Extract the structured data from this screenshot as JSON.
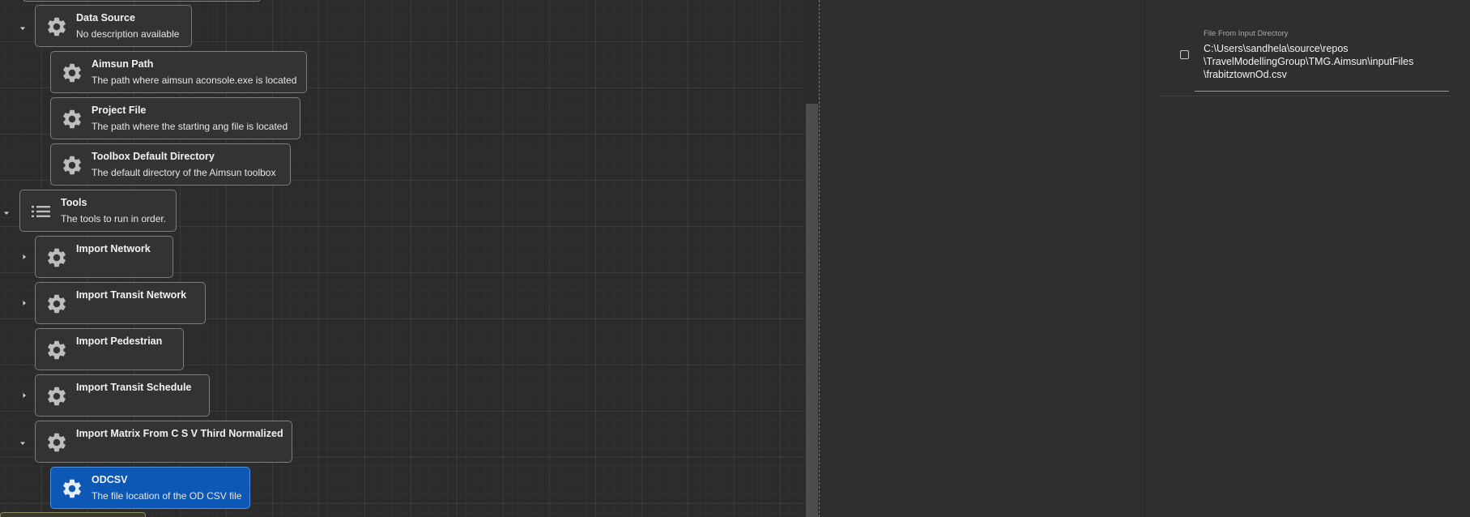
{
  "tree": {
    "nodes": [
      {
        "id": "data-source",
        "title": "Data Source",
        "description": "No description available",
        "icon": "gear-icon",
        "expanded": true
      },
      {
        "id": "aimsun-path",
        "title": "Aimsun Path",
        "description": "The path where aimsun aconsole.exe is located",
        "icon": "gear-icon"
      },
      {
        "id": "project-file",
        "title": "Project File",
        "description": "The path where the starting ang file is located",
        "icon": "gear-icon"
      },
      {
        "id": "toolbox-default-directory",
        "title": "Toolbox Default Directory",
        "description": "The default directory of the Aimsun toolbox",
        "icon": "gear-icon"
      },
      {
        "id": "tools",
        "title": "Tools",
        "description": "The tools to run in order.",
        "icon": "list-icon",
        "expanded": true
      },
      {
        "id": "import-network",
        "title": "Import Network",
        "description": "",
        "icon": "gear-icon",
        "expanded": false
      },
      {
        "id": "import-transit-network",
        "title": "Import Transit Network",
        "description": "",
        "icon": "gear-icon",
        "expanded": false
      },
      {
        "id": "import-pedestrian",
        "title": "Import Pedestrian",
        "description": "",
        "icon": "gear-icon"
      },
      {
        "id": "import-transit-schedule",
        "title": "Import Transit Schedule",
        "description": "",
        "icon": "gear-icon",
        "expanded": false
      },
      {
        "id": "import-matrix",
        "title": "Import Matrix From C S V Third Normalized",
        "description": "",
        "icon": "gear-icon",
        "expanded": true
      },
      {
        "id": "odcsv",
        "title": "ODCSV",
        "description": "The file location of the OD CSV file",
        "icon": "gear-icon",
        "selected": true
      }
    ]
  },
  "properties": {
    "field_label": "File From Input Directory",
    "checkbox_checked": false,
    "value_lines": [
      "C:\\Users\\sandhela\\source\\repos",
      "\\TravelModellingGroup\\TMG.Aimsun\\inputFiles",
      "\\frabitztownOd.csv"
    ]
  },
  "colors": {
    "selected_node": "#0c58b4",
    "node_background": "#333333",
    "node_border": "#7c7c7c",
    "panel_background": "#2f2f2f"
  }
}
